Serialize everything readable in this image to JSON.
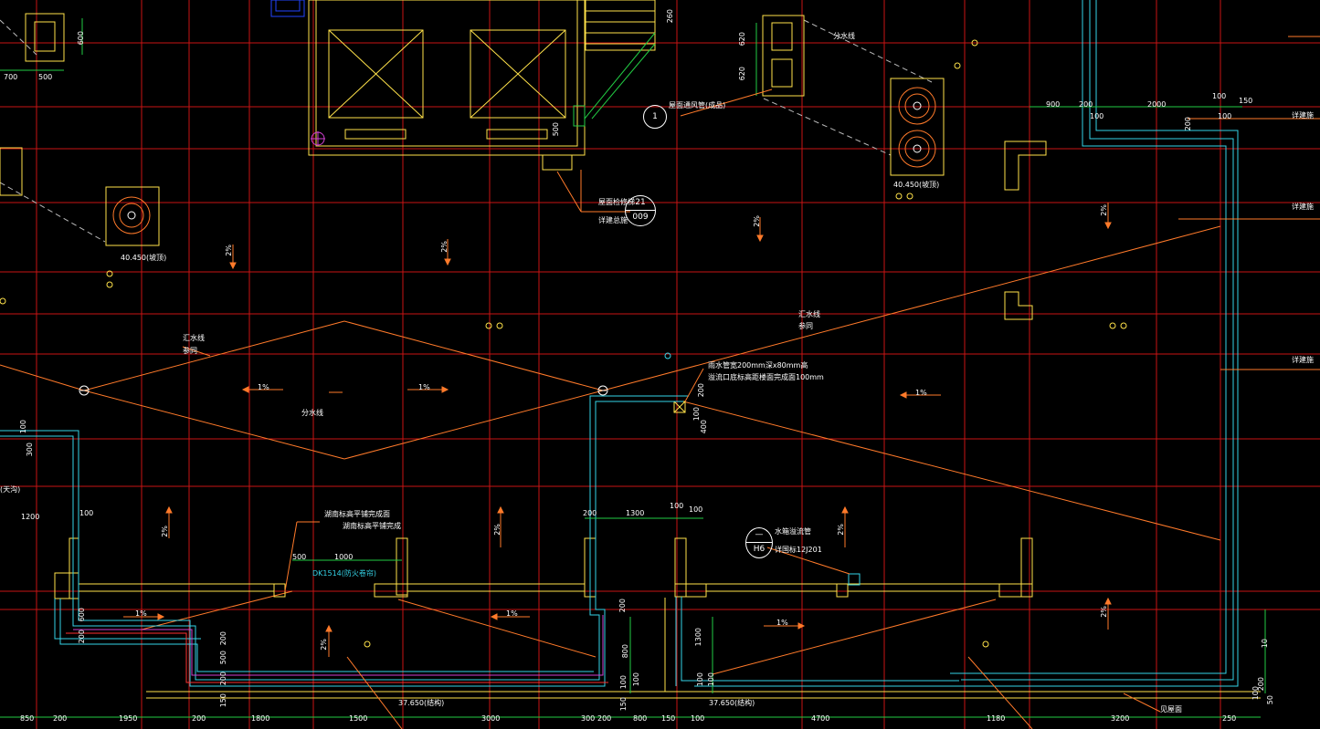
{
  "dims": {
    "bottom": [
      "850",
      "200",
      "1950",
      "200",
      "1800",
      "1500",
      "3000",
      "300",
      "200",
      "800",
      "150",
      "100",
      "4700",
      "1180",
      "3200",
      "250"
    ],
    "top_left": [
      "700",
      "500",
      "600"
    ],
    "right_top": [
      "900",
      "200",
      "2000",
      "100",
      "150",
      "100",
      "100"
    ],
    "mid_right": [
      "100",
      "1300",
      "200",
      "100",
      "200"
    ],
    "left_mid": [
      "100",
      "300",
      "100",
      "1200",
      "600",
      "200"
    ],
    "lower_mid": [
      "500",
      "1000",
      "200",
      "500",
      "200",
      "1300",
      "200",
      "800",
      "100",
      "100",
      "1300",
      "100",
      "100",
      "100",
      "150",
      "150",
      "200",
      "50",
      "10"
    ],
    "stair": [
      "260",
      "620",
      "620",
      "500",
      "200",
      "400",
      "100"
    ]
  },
  "elev": {
    "left_fan": "40.450(坡顶)",
    "right_fan": "40.450(坡顶)",
    "bottom_left": "37.650(结构)",
    "bottom_mid": "37.650(结构)"
  },
  "slopes": [
    "2%",
    "2%",
    "2%",
    "2%",
    "2%",
    "2%",
    "2%",
    "2%",
    "2%",
    "1%",
    "1%",
    "1%",
    "1%",
    "1%",
    "1%"
  ],
  "notes": {
    "roof_vent": "屋面通风管(成品)",
    "roof_drain": "屋面检修梯",
    "see_detail": "详建总施",
    "rain_1": "雨水管宽200mm深x80mm高",
    "rain_2": "溢流口底标高距楼面完成面100mm",
    "drain_line_1": "汇水线",
    "drain_line_2": "分水线",
    "water_note": "水箱溢流管",
    "water_ref": "详国标12J201",
    "edge_1": "湖南标高平铺完成面",
    "edge_2": "湖南标高平铺完成",
    "dk": "DK1514(防火卷帘)",
    "right_1": "详建施",
    "right_2": "详建施",
    "right_3": "详建施",
    "bottom_right": "见屋面",
    "divide": "分水线",
    "same": "参同",
    "huishui": "汇水线",
    "fenshui": "分水线",
    "left_note": "(天沟)"
  },
  "bubbles": {
    "b1": "1",
    "b21_top": "21",
    "b21_bot": "009",
    "h6_top": "—",
    "h6_bot": "H6"
  },
  "colors": {
    "grid": "#e01818",
    "wall": "#ffe24a",
    "slope": "#ff7a2a",
    "cyan": "#35d4e8",
    "text": "#ffffff",
    "green": "#22cc44",
    "blue": "#2244ff"
  }
}
